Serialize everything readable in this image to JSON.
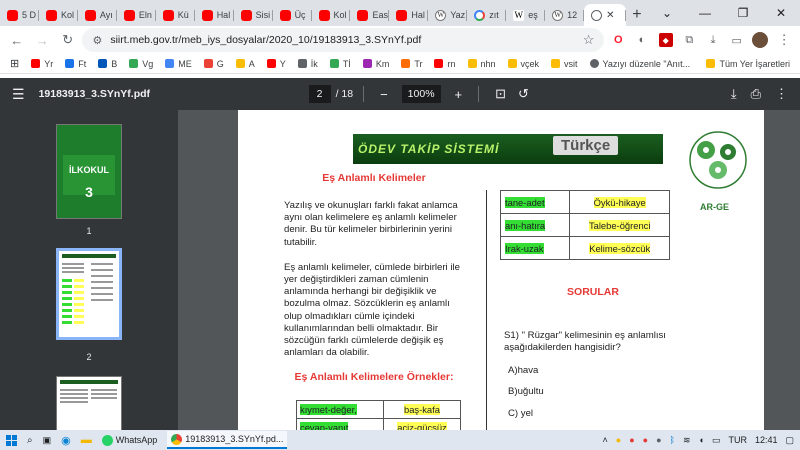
{
  "tabs": [
    {
      "label": "5 D",
      "icon": "youtube-icon"
    },
    {
      "label": "Kol",
      "icon": "youtube-icon"
    },
    {
      "label": "Ayı",
      "icon": "youtube-icon"
    },
    {
      "label": "Eln",
      "icon": "youtube-icon"
    },
    {
      "label": "Kü",
      "icon": "youtube-icon"
    },
    {
      "label": "Hal",
      "icon": "youtube-icon"
    },
    {
      "label": "Sisi",
      "icon": "youtube-icon"
    },
    {
      "label": "Üç",
      "icon": "youtube-icon"
    },
    {
      "label": "Kol",
      "icon": "youtube-icon"
    },
    {
      "label": "Eas",
      "icon": "youtube-icon"
    },
    {
      "label": "Hal",
      "icon": "youtube-icon"
    },
    {
      "label": "Yaz",
      "icon": "wordpress-icon"
    },
    {
      "label": "zıt",
      "icon": "google-icon"
    },
    {
      "label": "eş",
      "icon": "wikipedia-icon"
    },
    {
      "label": "12",
      "icon": "wordpress-icon"
    },
    {
      "label": "",
      "icon": "globe-icon",
      "active": true
    }
  ],
  "window_controls": {
    "minimize": "—",
    "maximize": "❐",
    "close": "✕"
  },
  "omnibox": {
    "url": "siirt.meb.gov.tr/meb_iys_dosyalar/2020_10/19183913_3.SYnYf.pdf"
  },
  "bookmarks": [
    {
      "label": "Yr",
      "color": "#ff0000"
    },
    {
      "label": "Ft",
      "color": "#1a73e8"
    },
    {
      "label": "B",
      "color": "#0057b7"
    },
    {
      "label": "Vg",
      "color": "#34a853"
    },
    {
      "label": "ME",
      "color": "#4285f4"
    },
    {
      "label": "G",
      "color": "#ea4335"
    },
    {
      "label": "A",
      "color": "#fbbc05"
    },
    {
      "label": "Y",
      "color": "#ff0000"
    },
    {
      "label": "İk",
      "color": "#5f6368"
    },
    {
      "label": "Tİ",
      "color": "#34a853"
    },
    {
      "label": "Km",
      "color": "#9c27b0"
    },
    {
      "label": "Tr",
      "color": "#ff6d00"
    },
    {
      "label": "rn",
      "color": "#ff0000"
    },
    {
      "label": "nhn",
      "color": "#fbbc05"
    },
    {
      "label": "vçek",
      "color": "#fbbc05"
    },
    {
      "label": "vsit",
      "color": "#fbbc05"
    },
    {
      "label": "Yazıyı düzenle \"Anıt...",
      "color": "#5f6368"
    }
  ],
  "bookmarks_all": "Tüm Yer İşaretleri",
  "pdf": {
    "filename": "19183913_3.SYnYf.pdf",
    "page_current": "2",
    "page_total": "/ 18",
    "zoom": "100%",
    "thumbnails": [
      "1",
      "2"
    ]
  },
  "doc": {
    "banner_title": "ÖDEV TAKİP SİSTEMİ",
    "subject": "Türkçe",
    "logo_text": "AR-GE",
    "heading": "Eş Anlamlı Kelimeler",
    "para1": "Yazılış ve okunuşları farklı fakat anlamca aynı olan kelimelere eş anlamlı kelimeler denir. Bu tür kelimeler birbirlerinin yerini tutabilir.",
    "para2": "Eş anlamlı kelimeler, cümlede birbirleri ile yer değiştirdikleri zaman cümlenin anlamında herhangi bir değişiklik ve bozulma olmaz. Sözcüklerin eş anlamlı olup olmadıkları cümle içindeki kullanımlarından belli olmaktadır. Bir sözcüğün farklı cümlelerde değişik eş anlamları da olabilir.",
    "examples_heading": "Eş Anlamlı Kelimelere Örnekler:",
    "examples": [
      [
        "kıymet-değer,",
        "baş-kafa"
      ],
      [
        "cevap-yanıt",
        "aciz-güçsüz"
      ]
    ],
    "right_table": [
      [
        "tane-adet",
        "Öykü-hikaye"
      ],
      [
        "anı-hatıra",
        "Talebe-öğrenci"
      ],
      [
        "Irak-uzak",
        "Kelime-sözcük"
      ]
    ],
    "questions_heading": "SORULAR",
    "question1": "S1) \" Rüzgar\" kelimesinin eş anlamlısı aşağıdakilerden hangisidir?",
    "options": [
      "A)hava",
      "B)uğultu",
      "C) yel"
    ]
  },
  "taskbar": {
    "apps": [
      {
        "label": "WhatsApp"
      },
      {
        "label": "19183913_3.SYnYf.pd..."
      }
    ],
    "language": "TUR",
    "time": "12:41"
  }
}
